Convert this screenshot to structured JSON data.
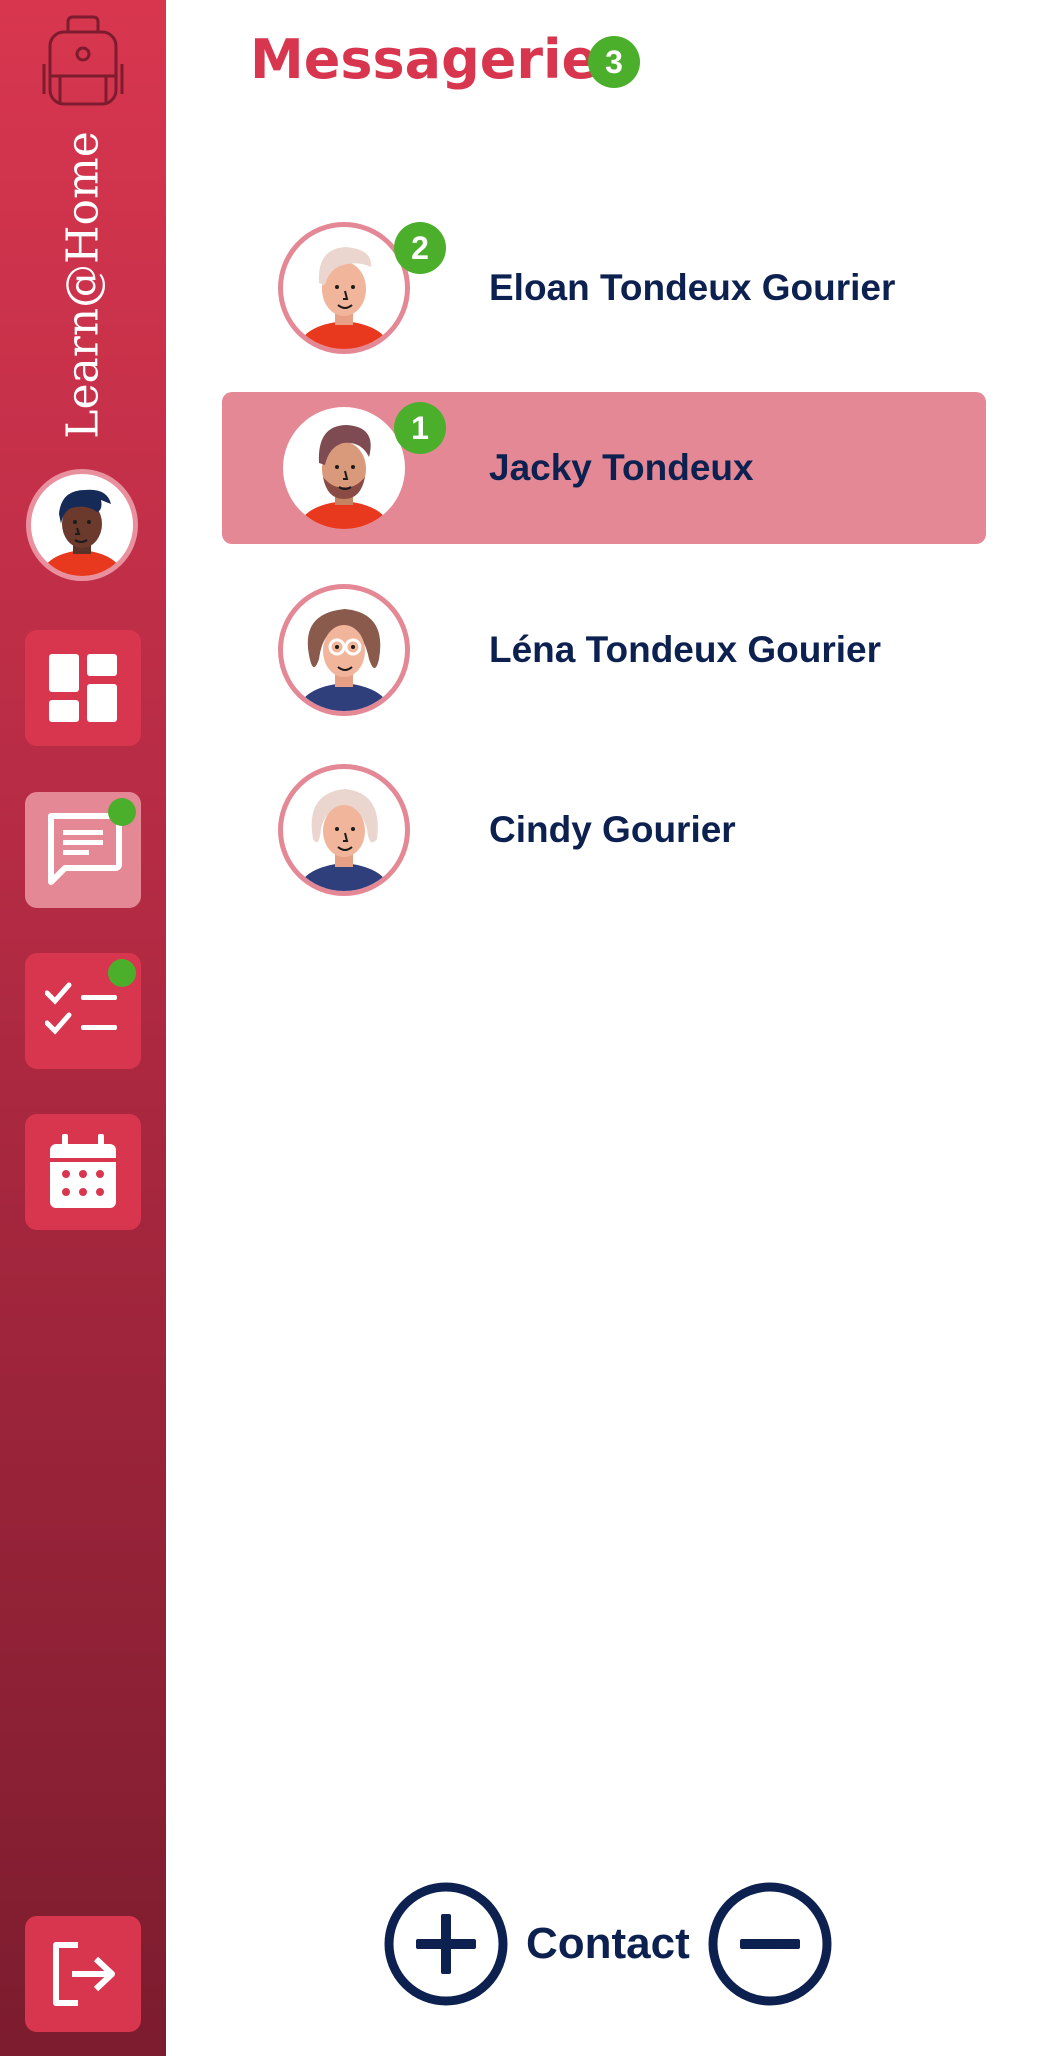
{
  "sidebar": {
    "brand": "Learn@Home",
    "nav": [
      {
        "name": "dashboard",
        "icon": "dashboard-icon",
        "active": false,
        "dot": false
      },
      {
        "name": "messages",
        "icon": "chat-icon",
        "active": true,
        "dot": true
      },
      {
        "name": "tasks",
        "icon": "checklist-icon",
        "active": false,
        "dot": true
      },
      {
        "name": "calendar",
        "icon": "calendar-icon",
        "active": false,
        "dot": false
      }
    ],
    "logout_icon": "logout-icon"
  },
  "header": {
    "title": "Messagerie",
    "unread_count": "3"
  },
  "contacts": [
    {
      "name": "Eloan Tondeux Gourier",
      "unread": "2",
      "selected": false
    },
    {
      "name": "Jacky Tondeux",
      "unread": "1",
      "selected": true
    },
    {
      "name": "Léna Tondeux Gourier",
      "unread": null,
      "selected": false
    },
    {
      "name": "Cindy Gourier",
      "unread": null,
      "selected": false
    }
  ],
  "footer": {
    "label": "Contact",
    "add_icon": "plus-circle-icon",
    "remove_icon": "minus-circle-icon"
  },
  "colors": {
    "accent": "#d8364f",
    "accent_light": "#e58896",
    "badge": "#4caf2c",
    "text_dark": "#0d2150"
  }
}
